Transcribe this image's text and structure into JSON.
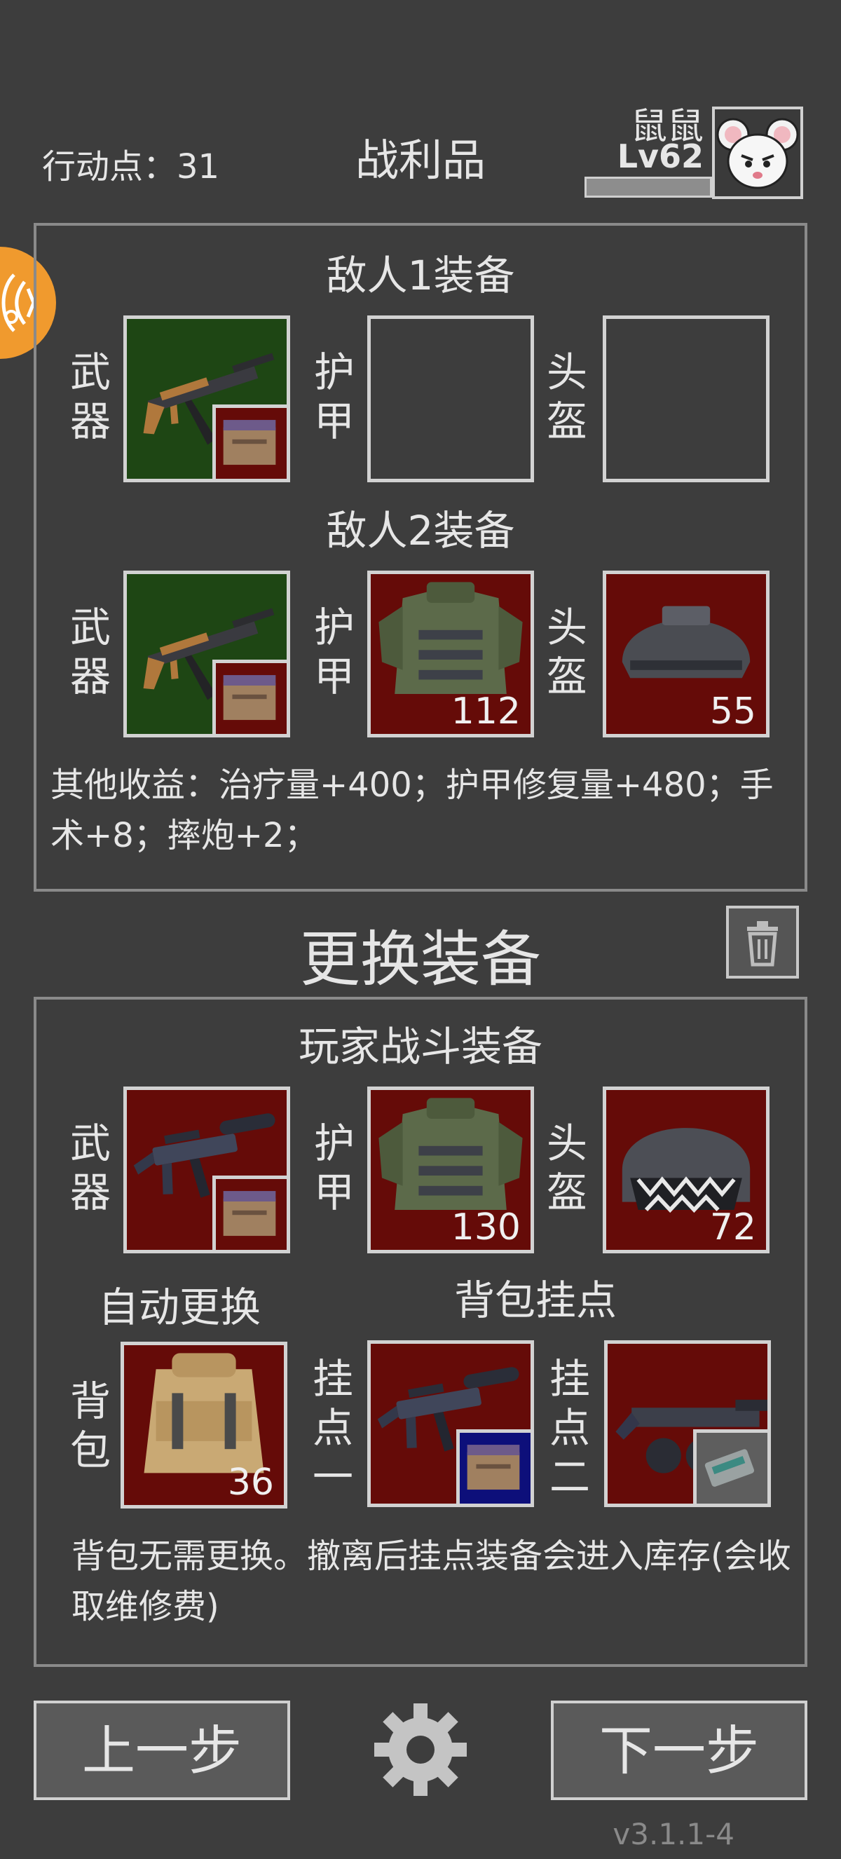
{
  "header": {
    "action_points": "行动点：31",
    "title": "战利品",
    "username": "鼠鼠",
    "level": "Lv62"
  },
  "enemy1": {
    "title": "敌人1装备",
    "weapon_label": "武器",
    "armor_label": "护甲",
    "helmet_label": "头盔"
  },
  "enemy2": {
    "title": "敌人2装备",
    "weapon_label": "武器",
    "armor_label": "护甲",
    "armor_durability": "112",
    "helmet_label": "头盔",
    "helmet_durability": "55"
  },
  "other_gains": "其他收益：治疗量+400；护甲修复量+480；手术+8；摔炮+2；",
  "change_title": "更换装备",
  "player": {
    "title": "玩家战斗装备",
    "weapon_label": "武器",
    "armor_label": "护甲",
    "armor_durability": "130",
    "helmet_label": "头盔",
    "helmet_durability": "72",
    "auto_replace": "自动更换",
    "backpack_mount_title": "背包挂点",
    "backpack_label": "背包",
    "backpack_value": "36",
    "mount1_label": "挂点一",
    "mount2_label": "挂点二",
    "note": "背包无需更换。撤离后挂点装备会进入库存(会收取维修费)"
  },
  "buttons": {
    "prev": "上一步",
    "next": "下一步"
  },
  "version": "v3.1.1-4",
  "colors": {
    "background": "#3d3d3d",
    "slot_green": "#1e4614",
    "slot_red": "#650b08",
    "accent_orange": "#f09a2e"
  }
}
